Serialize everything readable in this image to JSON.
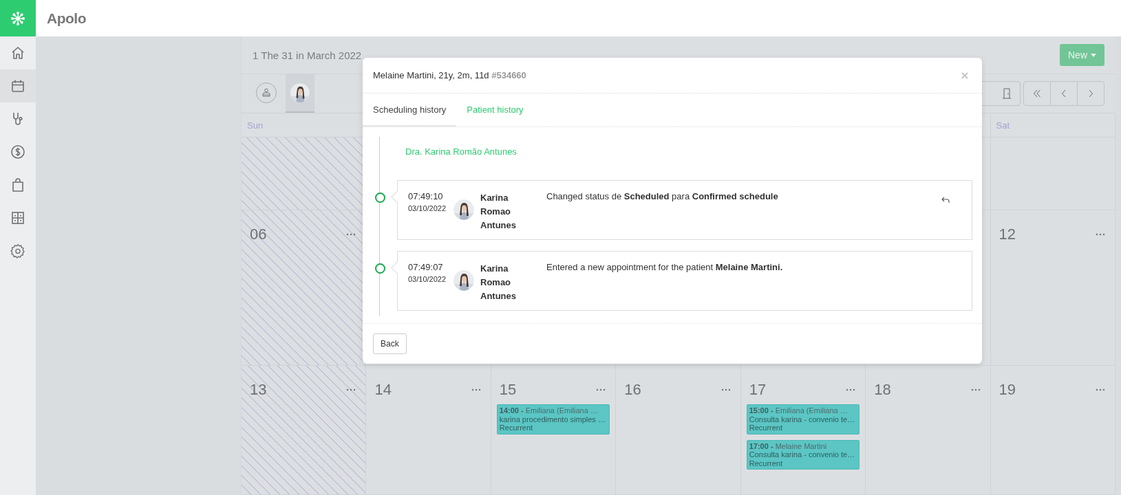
{
  "app": {
    "name": "Apolo"
  },
  "sidebar": {
    "items": [
      {
        "selected": false
      },
      {
        "selected": true
      },
      {
        "selected": false
      },
      {
        "selected": false
      },
      {
        "selected": false
      },
      {
        "selected": false
      },
      {
        "selected": false
      }
    ]
  },
  "calendar": {
    "title": "1 The 31 in March 2022",
    "new_button": "New",
    "professionals": [
      {
        "kind": "all",
        "selected": false
      },
      {
        "kind": "person",
        "selected": true
      }
    ],
    "weekdays": {
      "sun": "Sun",
      "sat": "Sat"
    },
    "weeks": [
      {
        "sun": {
          "unavailable": true
        },
        "sat": {
          "unavailable": false
        }
      },
      {
        "sun": {
          "number": "06",
          "unavailable": true
        },
        "sat": {
          "number": "12",
          "unavailable": false
        }
      },
      {
        "sun": {
          "number": "13",
          "unavailable": true
        },
        "mon": {
          "number": "14",
          "unavailable": false
        },
        "tue": {
          "number": "15",
          "unavailable": false,
          "events": [
            {
              "time": "14:00 -",
              "title": "Emiliana (Emiliana …",
              "detail": "karina procedimento simples …",
              "recurrence": "Recurrent"
            }
          ]
        },
        "wed": {
          "number": "16",
          "unavailable": false
        },
        "thu": {
          "number": "17",
          "unavailable": false,
          "events": [
            {
              "time": "15:00 -",
              "title": "Emiliana (Emiliana …",
              "detail": "Consulta karina - convenio te…",
              "recurrence": "Recurrent"
            },
            {
              "time": "17:00 -",
              "title": "Melaine Martini",
              "detail": "Consulta karina - convenio te…",
              "recurrence": "Recurrent"
            }
          ]
        },
        "fri": {
          "number": "18",
          "unavailable": false
        },
        "sat": {
          "number": "19",
          "unavailable": false
        }
      }
    ]
  },
  "modal": {
    "title": "Melaine Martini, 21y, 2m, 11d",
    "record_id": "#534660",
    "tabs": [
      {
        "label": "Scheduling history",
        "selected": true
      },
      {
        "label": "Patient history",
        "selected": false
      }
    ],
    "professional": "Dra. Karina Romão Antunes",
    "entries": [
      {
        "time": "07:49:10",
        "date": "03/10/2022",
        "author": "Karina Romao Antunes",
        "message": "Changed status de **Scheduled** para **Confirmed schedule**",
        "undoable": true
      },
      {
        "time": "07:49:07",
        "date": "03/10/2022",
        "author": "Karina Romao Antunes",
        "message": "Entered a new appointment for the patient **Melaine Martini.**",
        "undoable": false
      }
    ],
    "back_button": "Back"
  }
}
